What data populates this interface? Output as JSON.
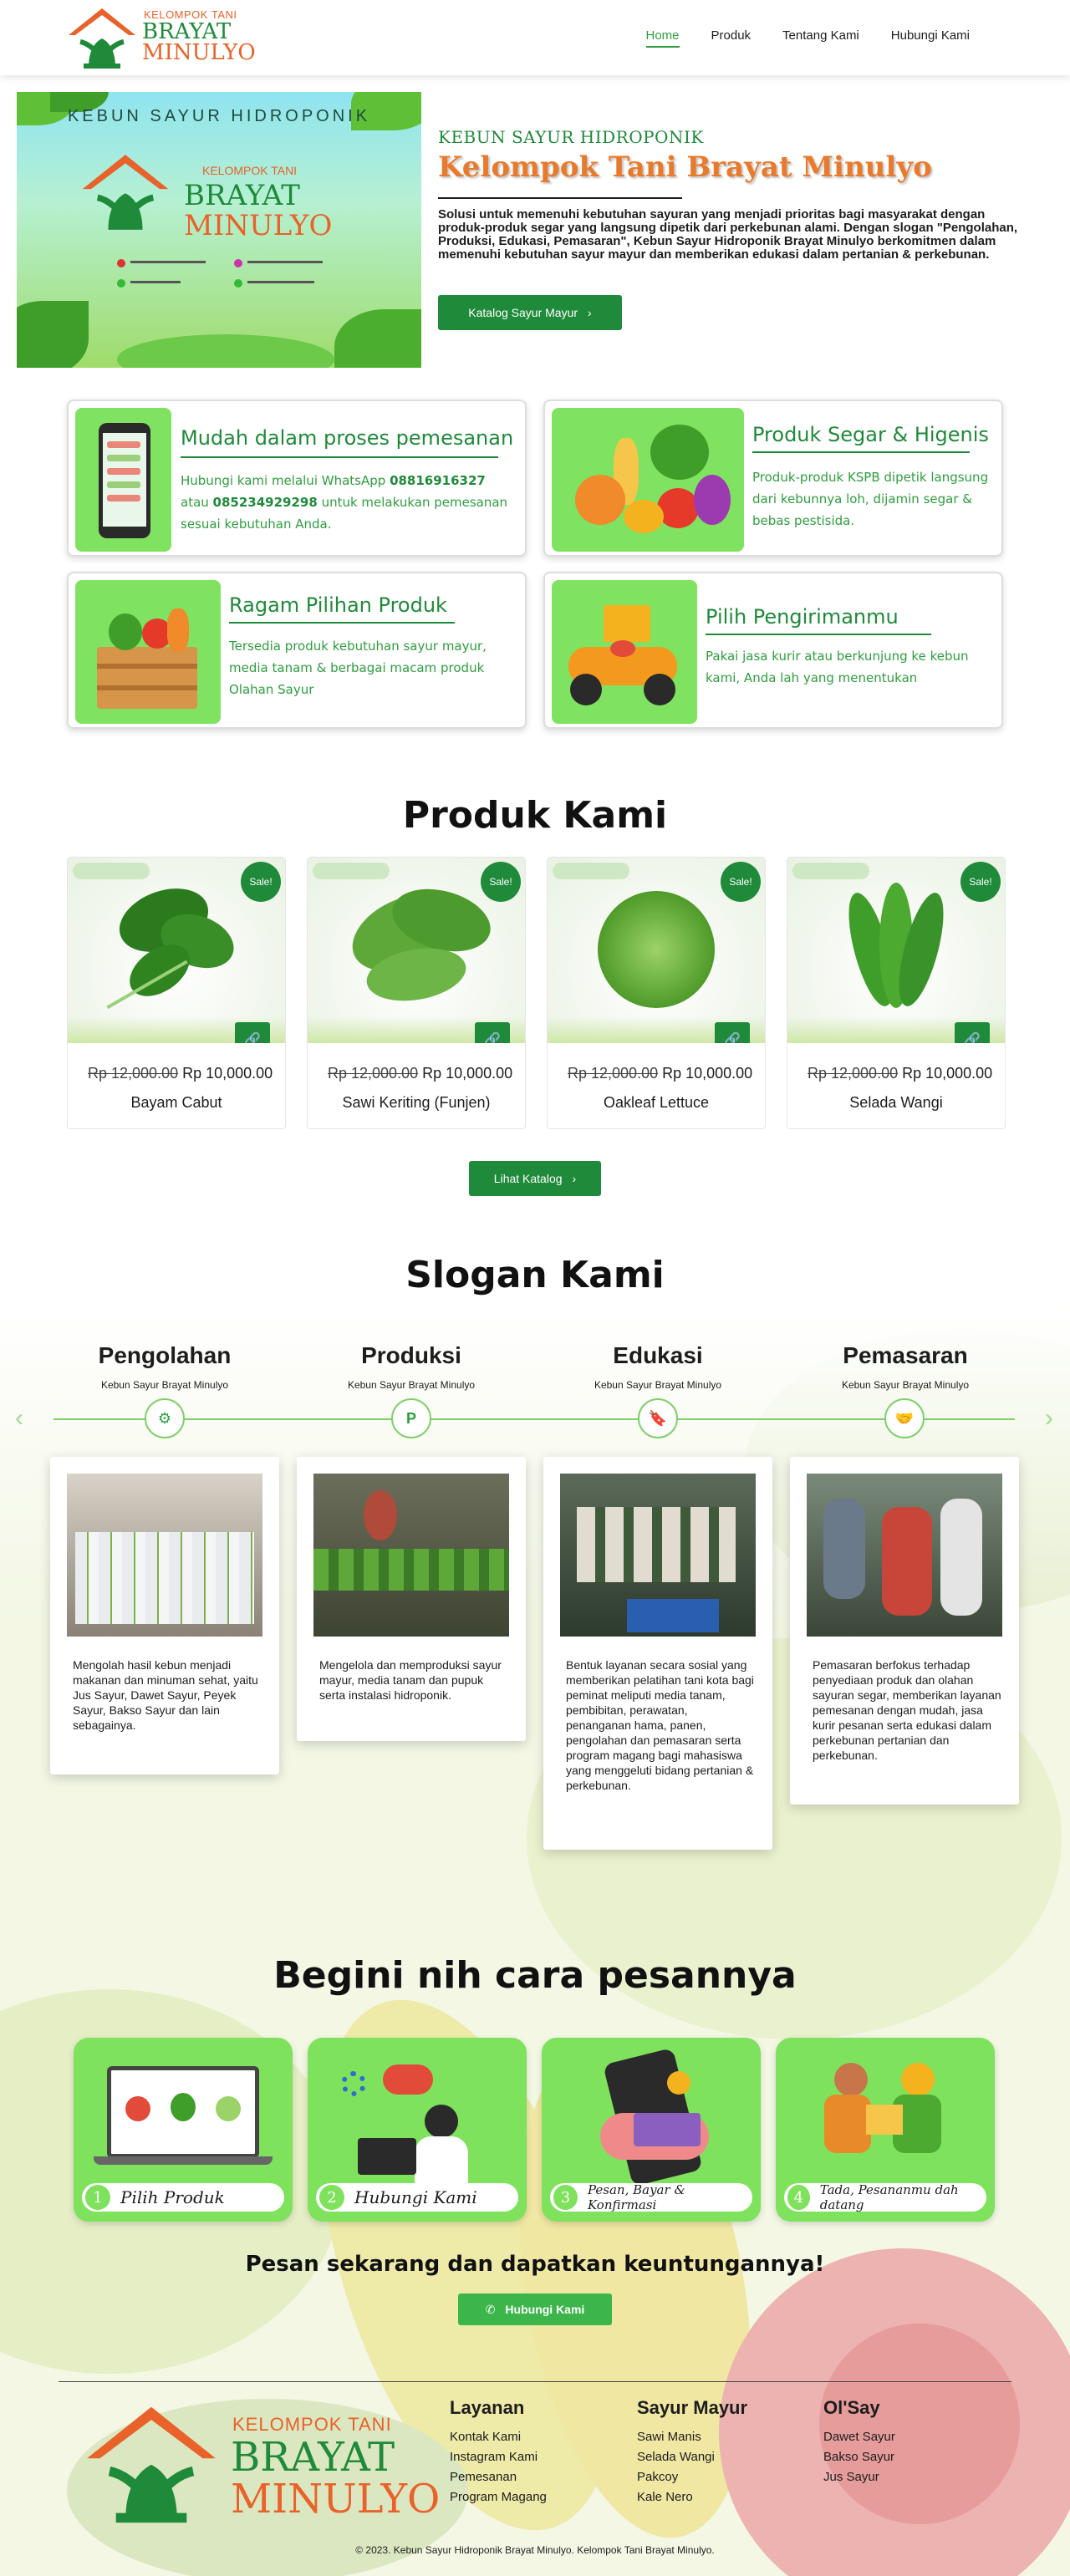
{
  "header": {
    "logo_top": "KELOMPOK TANI",
    "logo_line1": "BRAYAT",
    "logo_line2": "MINULYO",
    "nav": [
      {
        "label": "Home"
      },
      {
        "label": "Produk"
      },
      {
        "label": "Tentang Kami"
      },
      {
        "label": "Hubungi Kami"
      }
    ]
  },
  "hero": {
    "banner_title": "KEBUN SAYUR HIDROPONIK",
    "banner_small": "KELOMPOK TANI",
    "banner_big1": "BRAYAT",
    "banner_big2": "MINULYO",
    "subtitle": "KEBUN SAYUR HIDROPONIK",
    "title": "Kelompok Tani Brayat Minulyo",
    "description": "Solusi untuk memenuhi kebutuhan sayuran yang menjadi prioritas bagi masyarakat dengan produk-produk segar yang langsung dipetik dari perkebunan alami. Dengan slogan \"Pengolahan, Produksi, Edukasi, Pemasaran\", Kebun Sayur Hidroponik Brayat Minulyo berkomitmen dalam memenuhi kebutuhan sayur mayur dan memberikan edukasi dalam pertanian & perkebunan.",
    "cta": "Katalog Sayur Mayur"
  },
  "features": [
    {
      "title": "Mudah dalam proses pemesanan",
      "text_a": "Hubungi kami melalui WhatsApp ",
      "phone1": "08816916327",
      "text_b": " atau ",
      "phone2": "085234929298",
      "text_c": " untuk melakukan pemesanan sesuai kebutuhan Anda."
    },
    {
      "title": "Produk Segar & Higenis",
      "text": "Produk-produk KSPB dipetik langsung dari kebunnya loh, dijamin segar & bebas pestisida."
    },
    {
      "title": "Ragam Pilihan Produk",
      "text": "Tersedia produk kebutuhan sayur mayur, media tanam & berbagai macam produk Olahan Sayur"
    },
    {
      "title": "Pilih Pengirimanmu",
      "text": "Pakai jasa kurir atau berkunjung ke kebun kami, Anda lah yang menentukan"
    }
  ],
  "products": {
    "heading": "Produk Kami",
    "sale_label": "Sale!",
    "items": [
      {
        "name": "Bayam Cabut",
        "old_price": "Rp 12,000.00",
        "price": "Rp 10,000.00"
      },
      {
        "name": "Sawi Keriting (Funjen)",
        "old_price": "Rp 12,000.00",
        "price": "Rp 10,000.00"
      },
      {
        "name": "Oakleaf Lettuce",
        "old_price": "Rp 12,000.00",
        "price": "Rp 10,000.00"
      },
      {
        "name": "Selada Wangi",
        "old_price": "Rp 12,000.00",
        "price": "Rp 10,000.00"
      }
    ],
    "cta": "Lihat Katalog"
  },
  "slogan": {
    "heading": "Slogan Kami",
    "items": [
      {
        "title": "Pengolahan",
        "sub": "Kebun Sayur Brayat Minulyo",
        "text": "Mengolah hasil kebun menjadi makanan dan minuman sehat, yaitu Jus Sayur, Dawet Sayur, Peyek Sayur, Bakso Sayur dan lain sebagainya."
      },
      {
        "title": "Produksi",
        "sub": "Kebun Sayur Brayat Minulyo",
        "text": "Mengelola dan memproduksi sayur mayur, media tanam dan pupuk serta instalasi hidroponik."
      },
      {
        "title": "Edukasi",
        "sub": "Kebun Sayur Brayat Minulyo",
        "text": "Bentuk layanan secara sosial yang memberikan pelatihan tani kota bagi peminat meliputi media tanam, pembibitan, perawatan, penanganan hama, panen, pengolahan dan pemasaran serta program magang bagi mahasiswa yang menggeluti bidang pertanian & perkebunan."
      },
      {
        "title": "Pemasaran",
        "sub": "Kebun Sayur Brayat Minulyo",
        "text": "Pemasaran berfokus terhadap penyediaan produk dan olahan sayuran segar, memberikan layanan pemesanan dengan mudah, jasa kurir pesanan serta edukasi dalam perkebunan pertanian dan perkebunan."
      }
    ]
  },
  "order": {
    "heading": "Begini nih cara pesannya",
    "steps": [
      {
        "num": "1",
        "label": "Pilih Produk"
      },
      {
        "num": "2",
        "label": "Hubungi Kami"
      },
      {
        "num": "3",
        "label": "Pesan, Bayar & Konfirmasi"
      },
      {
        "num": "4",
        "label": "Tada, Pesananmu dah datang"
      }
    ],
    "tagline": "Pesan sekarang dan dapatkan keuntungannya!",
    "cta": "Hubungi Kami"
  },
  "footer": {
    "logo_top": "KELOMPOK TANI",
    "logo_line1": "BRAYAT",
    "logo_line2": "MINULYO",
    "columns": [
      {
        "heading": "Layanan",
        "links": [
          "Kontak Kami",
          "Instagram Kami",
          "Pemesanan",
          "Program Magang"
        ]
      },
      {
        "heading": "Sayur Mayur",
        "links": [
          "Sawi Manis",
          "Selada Wangi",
          "Pakcoy",
          "Kale Nero"
        ]
      },
      {
        "heading": "Ol'Say",
        "links": [
          "Dawet Sayur",
          "Bakso Sayur",
          "Jus Sayur"
        ]
      }
    ],
    "copyright": "© 2023. Kebun Sayur Hidroponik Brayat Minulyo. Kelompok Tani Brayat Minulyo."
  },
  "colors": {
    "green": "#1f8a3a",
    "light_green": "#7ee25c",
    "orange": "#e97a2c"
  }
}
